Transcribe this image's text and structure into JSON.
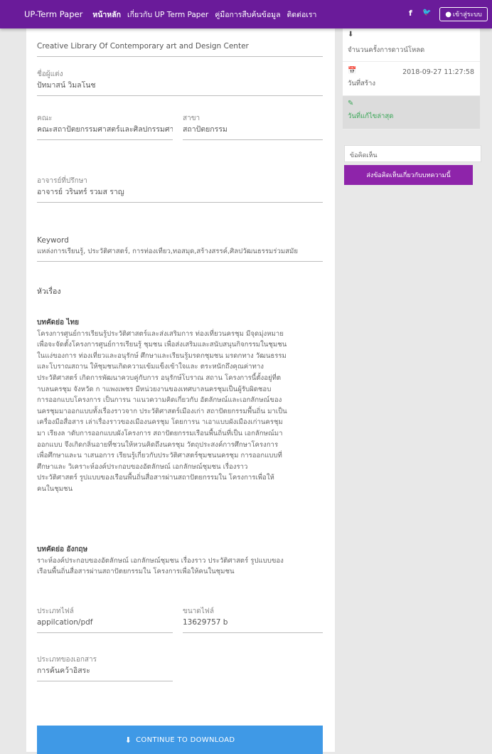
{
  "navbar": {
    "brand": "UP-Term Paper",
    "links": [
      "หน้าหลัก",
      "เกี่ยวกับ UP Term Paper",
      "คู่มือการสืบค้นข้อมูล",
      "ติดต่อเรา"
    ],
    "facebook_icon": "f",
    "twitter_icon": "🐦",
    "login_label": "เข้าสู่ระบบ",
    "accent": "#6a1b9a"
  },
  "record": {
    "institution_value": "Creative Library Of Contemporary art and Design Center",
    "author": {
      "label": "ชื่อผู้แต่ง",
      "value": "ปัทมาสน์ วิมลโนช"
    },
    "faculty": {
      "label": "คณะ",
      "value": "คณะสถาปัตยกรรมศาสตร์และศิลปกรรมศาสตร์"
    },
    "major": {
      "label": "สาขา",
      "value": "สถาปัตยกรรม"
    },
    "advisor": {
      "label": "อาจารย์ที่ปรึกษา",
      "value": "อาจารย์ วรินทร์ รวมส ราญ"
    },
    "keyword": {
      "label": "Keyword",
      "value": "แหล่งการเรียนรู้, ประวัติศาสตร์, การท่องเที่ยว,ทอสมุด,สร้างสรรค์,ศิลปวัฒนธรรมร่วมสมัย"
    },
    "subject_heading": "หัวเรื่อง",
    "abstract_th": {
      "title": "บทคัดย่อ ไทย",
      "lines": [
        "โครงการศูนย์การเรียนรู้ประวัติศาสตร์และส่งเสริมการ ท่องเที่ยวนครชุม มีจุดมุ่งหมาย",
        "เพื่อจะจัดตั้งโครงการศูนย์การเรียนรู้ ชุมชน เพื่อส่งเสริมและสนับสนุนกิจกรรมในชุมชน",
        "ในแง่ของการ ท่องเที่ยวและอนุรักษ์ ศึกษาและเรียนรู้มรดกชุมชน มรดกทาง วัฒนธรรม",
        "และโบราณสถาน ให้ชุมชนเกิดความเข้มแข็งเข้าใจและ ตระหนักถึงคุณค่าทาง",
        "ประวัติศาสตร์ เกิดการพัฒนาควบคู่กับการ อนุรักษ์โบราณ สถาน โครงการนี้ตั้งอยู่ที่ต",
        "าบลนครชุม จังหวัด ก าแพงเพชร มีหน่วยงานของเทศบาลนครชุมเป็นผู้รับผิดชอบ",
        "การออกแบบโครงการ เป็นการน าแนวความคิดเกี่ยวกับ อัตลักษณ์และเอกลักษณ์ของ",
        "นครชุมมาออกแบบทั้งเรื่องราวจาก ประวัติศาสตร์เมืองเก่า สถาปัตยกรรมพื้นถิ่น มาเป็น",
        "เครื่องมือสื่อสาร เล่าเรื่องราวของเมืองนครชุม โดยการน าเอาแบบผังเมืองเก่านครชุม",
        "มา เรียงล าดับการออกแบบผังโครงการ สถาปัตยกรรมเรือนพื้นถิ่นที่เป็น เอกลักษณ์มา",
        "ออกแบบ จึงเกิดกลิ่นอายที่ชวนให้หวนคิดถึงนครชุม วัตถุประสงค์การศึกษาโครงการ",
        "เพื่อศึกษาและน าเสนอการ เรียนรู้เกี่ยวกับประวัติศาสตร์ชุมชนนครชุม การออกแบบที่",
        "ศึกษาและ วิเคราะห์องค์ประกอบของอัตลักษณ์ เอกลักษณ์ชุมชน เรื่องราว",
        "ประวัติศาสตร์ รูปแบบของเรือนพื้นถิ่นสื่อสารผ่านสถาปัตยกรรมใน โครงการเพื่อให้",
        "คนในชุมชน"
      ]
    },
    "abstract_en": {
      "title": "บทคัดย่อ อังกฤษ",
      "lines": [
        "ราะห์องค์ประกอบของอัตลักษณ์ เอกลักษณ์ชุมชน เรื่องราว ประวัติศาสตร์ รูปแบบของ",
        "เรือนพื้นถิ่นสื่อสารผ่านสถาปัตยกรรมใน โครงการเพื่อให้คนในชุมชน"
      ]
    },
    "file_type": {
      "label": "ประเภทไฟล์",
      "value": "appilcation/pdf"
    },
    "file_size": {
      "label": "ขนาดไฟล์",
      "value": "13629757 b"
    },
    "doc_type": {
      "label": "ประเภทของเอกสาร",
      "value": "การค้นคว้าอิสระ"
    },
    "download_label": "CONTINUE TO DOWNLOAD",
    "download_color": "#3f99e6"
  },
  "sidebar": {
    "downloads": {
      "icon": "download-icon",
      "label": "จำนวนครั้งการดาวน์โหลด"
    },
    "created": {
      "icon": "calendar-icon",
      "label": "วันที่สร้าง",
      "value": "2018-09-27 11:27:58"
    },
    "updated": {
      "icon": "edit-icon",
      "label": "วันที่แก้ไขล่าสุด",
      "color": "#3aa657"
    },
    "comment_placeholder": "ข้อคิดเห็น",
    "comment_button": "ส่งข้อคิดเห็นเกี่ยวกับบทความนี้",
    "comment_button_color": "#8e24aa"
  }
}
